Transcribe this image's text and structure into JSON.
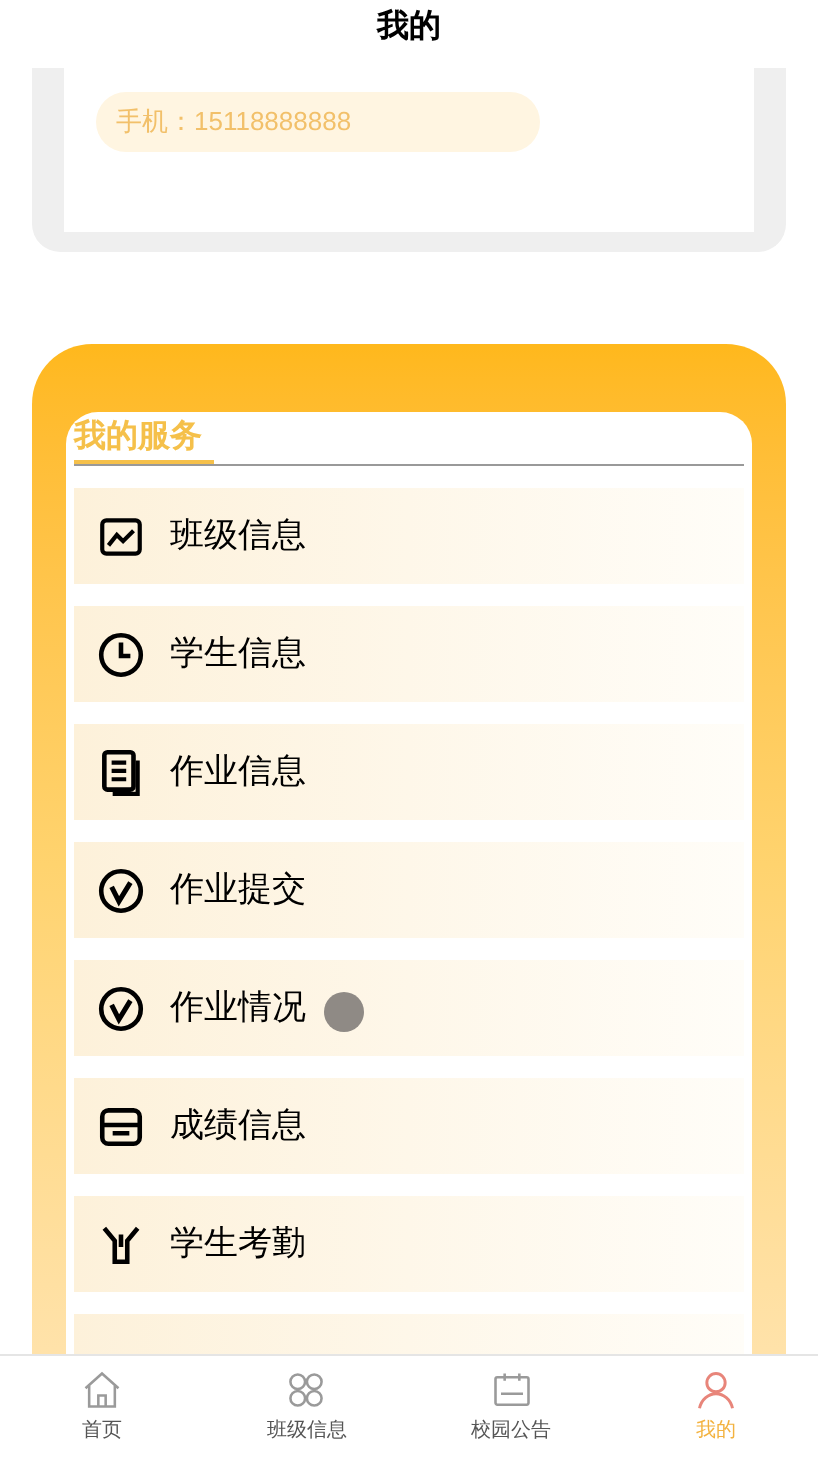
{
  "header": {
    "title": "我的"
  },
  "profile": {
    "phone": "手机：15118888888"
  },
  "services": {
    "title": "我的服务",
    "items": [
      {
        "label": "班级信息"
      },
      {
        "label": "学生信息"
      },
      {
        "label": "作业信息"
      },
      {
        "label": "作业提交"
      },
      {
        "label": "作业情况"
      },
      {
        "label": "成绩信息"
      },
      {
        "label": "学生考勤"
      }
    ]
  },
  "tab_bar": [
    {
      "label": "首页",
      "selected": false
    },
    {
      "label": "班级信息",
      "selected": false
    },
    {
      "label": "校园公告",
      "selected": false
    },
    {
      "label": "我的",
      "selected": true
    }
  ]
}
